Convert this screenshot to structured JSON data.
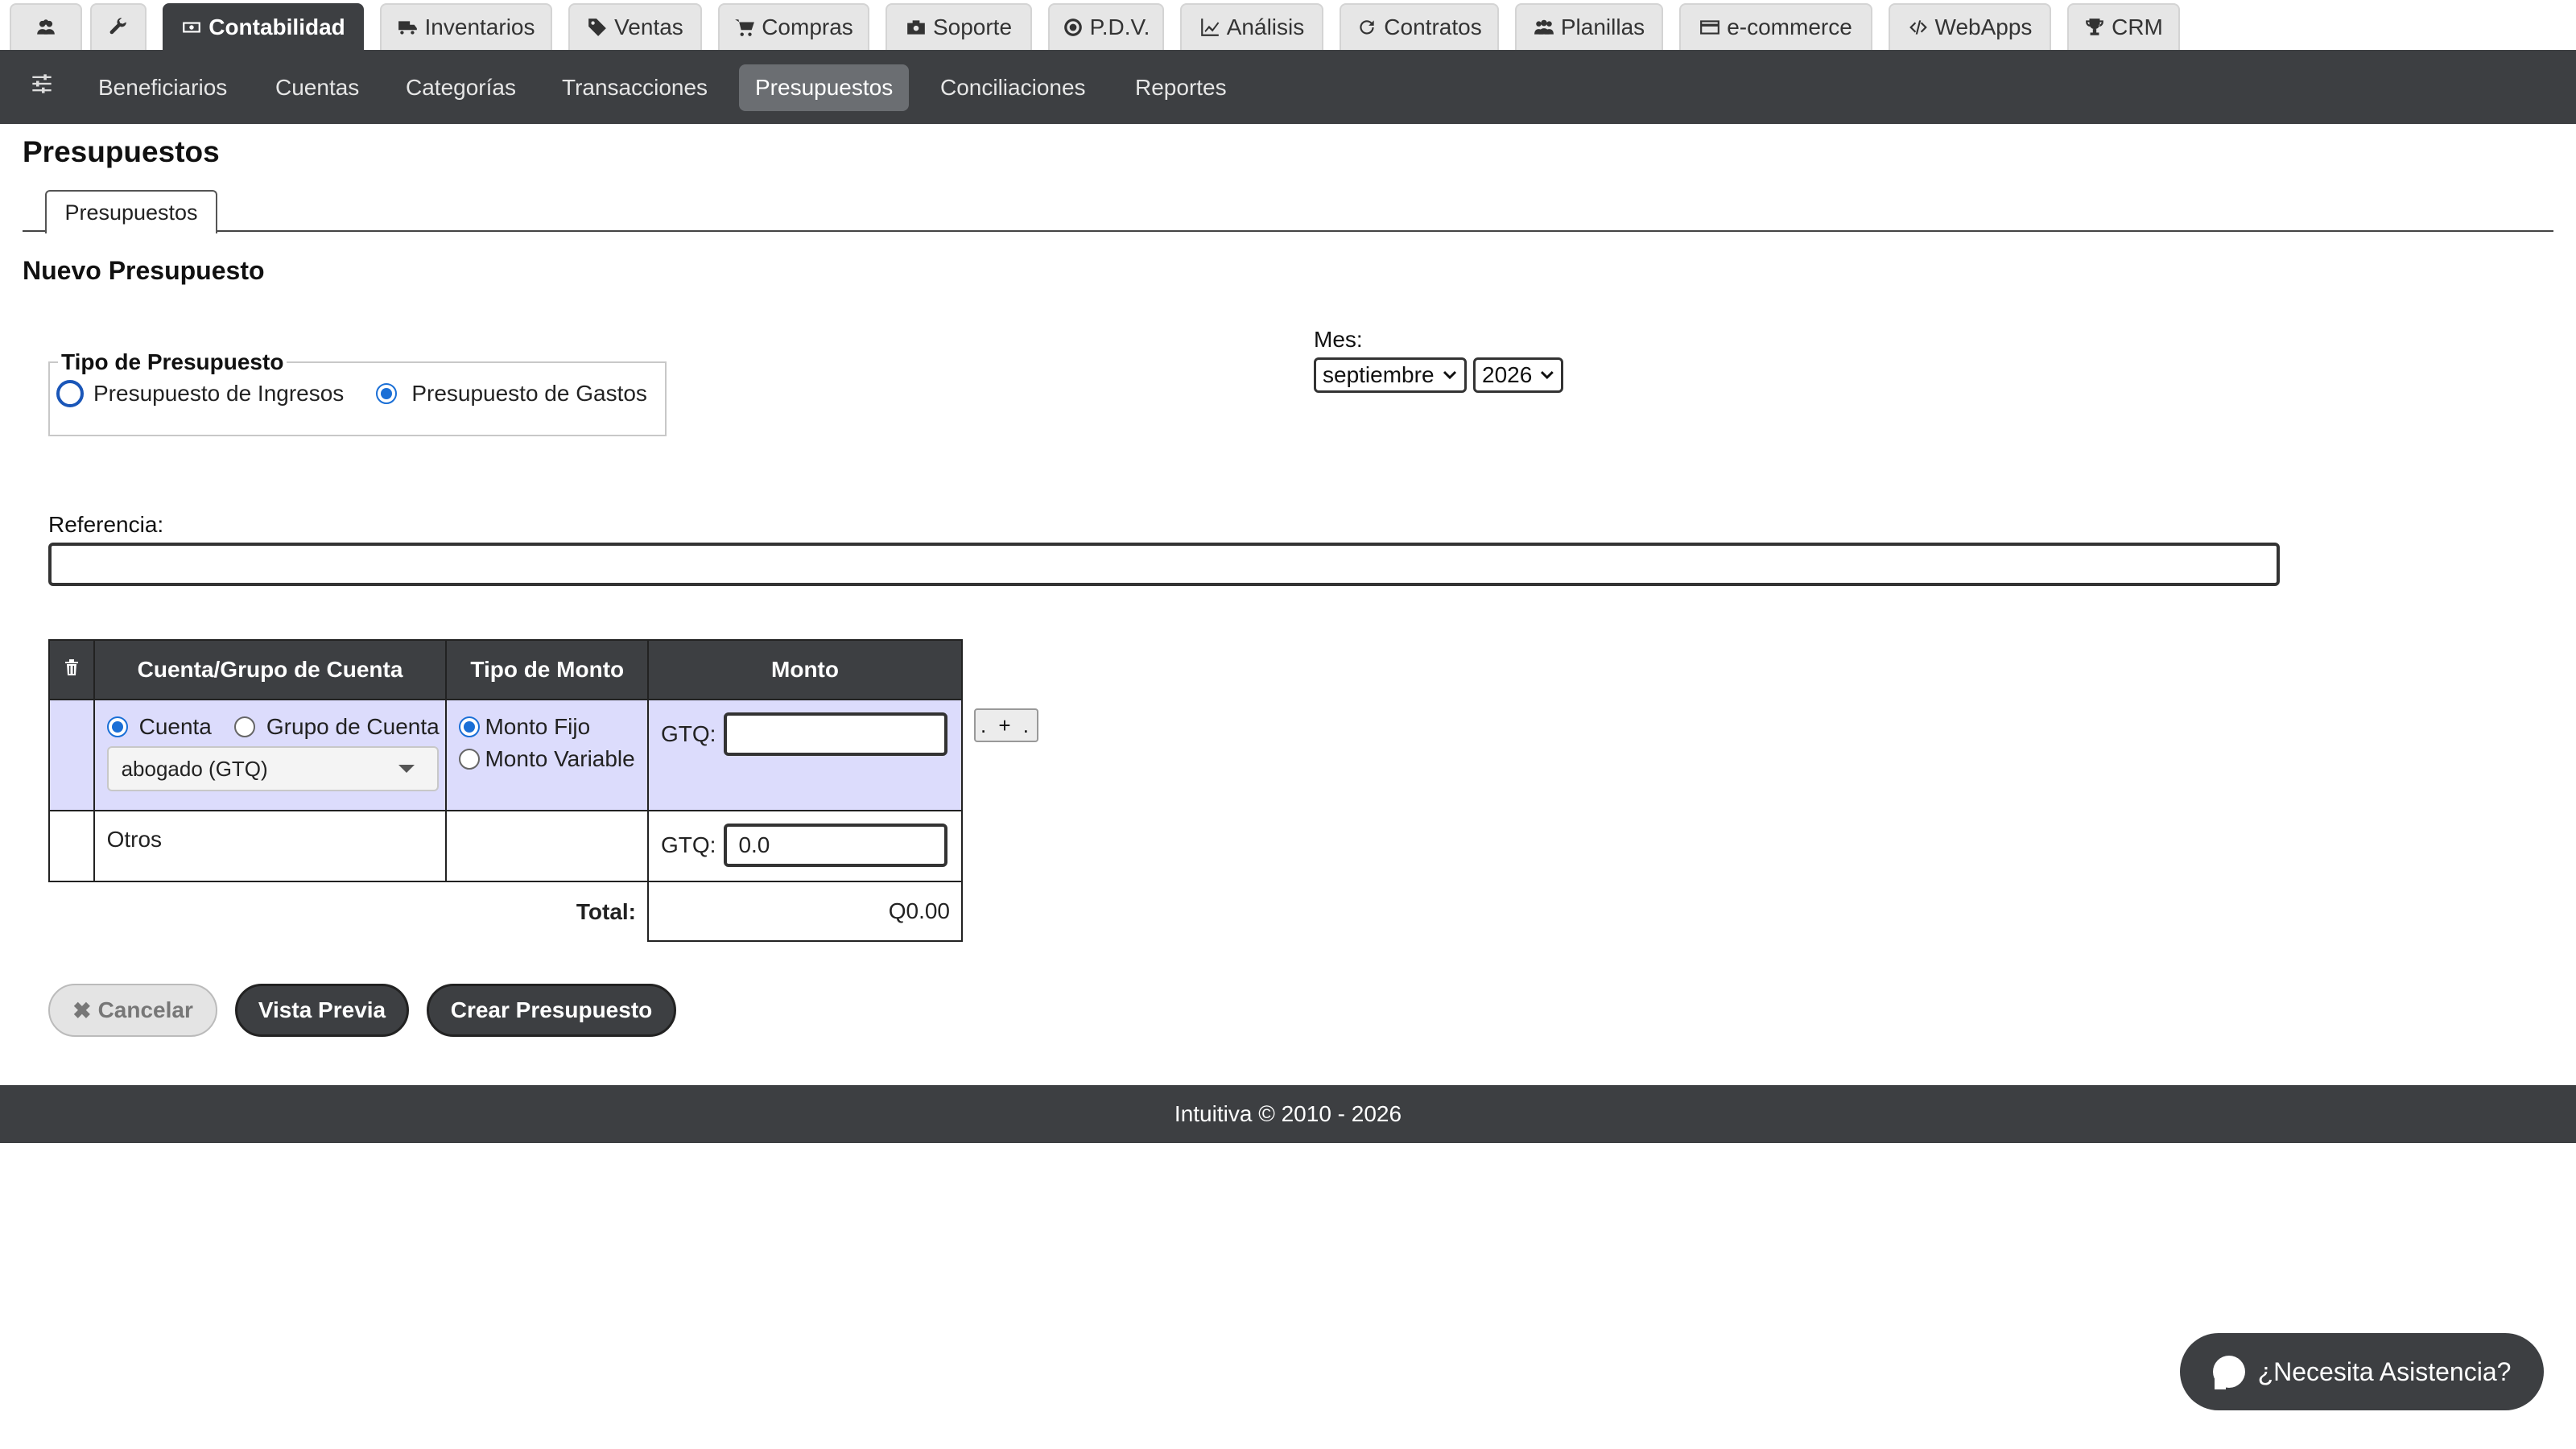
{
  "top_tabs": [
    {
      "label": "",
      "icon": "users-icon"
    },
    {
      "label": "",
      "icon": "wrench-icon"
    },
    {
      "label": "Contabilidad",
      "icon": "money-icon",
      "active": true
    },
    {
      "label": "Inventarios",
      "icon": "truck-icon"
    },
    {
      "label": "Ventas",
      "icon": "tag-icon"
    },
    {
      "label": "Compras",
      "icon": "cart-icon"
    },
    {
      "label": "Soporte",
      "icon": "briefcase-icon"
    },
    {
      "label": "P.D.V.",
      "icon": "target-icon"
    },
    {
      "label": "Análisis",
      "icon": "chart-line-icon"
    },
    {
      "label": "Contratos",
      "icon": "refresh-icon"
    },
    {
      "label": "Planillas",
      "icon": "group-icon"
    },
    {
      "label": "e-commerce",
      "icon": "credit-card-icon"
    },
    {
      "label": "WebApps",
      "icon": "code-icon"
    },
    {
      "label": "CRM",
      "icon": "trophy-icon"
    }
  ],
  "subnav": {
    "items": [
      "Beneficiarios",
      "Cuentas",
      "Categorías",
      "Transacciones",
      "Presupuestos",
      "Conciliaciones",
      "Reportes"
    ],
    "active": "Presupuestos"
  },
  "page": {
    "title": "Presupuestos",
    "content_tab": "Presupuestos",
    "section_title": "Nuevo Presupuesto"
  },
  "tipo": {
    "legend": "Tipo de Presupuesto",
    "options": [
      "Presupuesto de Ingresos",
      "Presupuesto de Gastos"
    ],
    "selected": "Presupuesto de Gastos"
  },
  "mes": {
    "label": "Mes:",
    "month": "septiembre",
    "year": "2026"
  },
  "referencia": {
    "label": "Referencia:",
    "value": ""
  },
  "table": {
    "headers": [
      "Cuenta/Grupo de Cuenta",
      "Tipo de Monto",
      "Monto"
    ],
    "row1": {
      "option_cuenta": "Cuenta",
      "option_grupo": "Grupo de Cuenta",
      "account": "abogado (GTQ)",
      "option_fijo": "Monto Fijo",
      "option_variable": "Monto Variable",
      "currency": "GTQ:",
      "amount": ""
    },
    "row2": {
      "label": "Otros",
      "currency": "GTQ:",
      "amount": "0.0"
    },
    "total_label": "Total:",
    "total_value": "Q0.00",
    "add_button": ". + ."
  },
  "buttons": {
    "cancel": "Cancelar",
    "preview": "Vista Previa",
    "create": "Crear Presupuesto"
  },
  "footer": "Intuitiva © 2010 - 2026",
  "help": "¿Necesita Asistencia?"
}
